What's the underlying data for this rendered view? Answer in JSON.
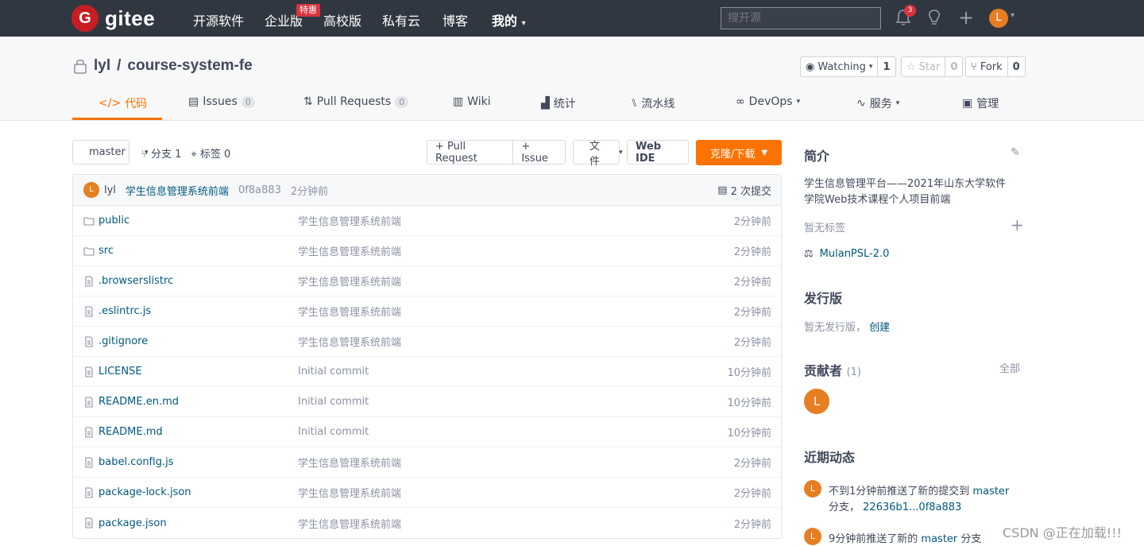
{
  "nav": {
    "logo_letter": "G",
    "logo_text": "gitee",
    "items": [
      "开源软件",
      "企业版",
      "高校版",
      "私有云",
      "博客",
      "我的"
    ],
    "promo_badge": "特惠",
    "search_placeholder": "搜开源",
    "notification_count": "3",
    "avatar_letter": "L"
  },
  "repo": {
    "owner": "lyl",
    "sep": "/",
    "name": "course-system-fe",
    "watch_label": "Watching",
    "watch_count": "1",
    "star_label": "Star",
    "star_count": "0",
    "fork_label": "Fork",
    "fork_count": "0"
  },
  "tabs": [
    {
      "label": "代码",
      "icon": "code-icon"
    },
    {
      "label": "Issues",
      "count": "0",
      "icon": "issues-icon"
    },
    {
      "label": "Pull Requests",
      "count": "0",
      "icon": "pull-request-icon"
    },
    {
      "label": "Wiki",
      "icon": "wiki-icon"
    },
    {
      "label": "统计",
      "icon": "chart-icon"
    },
    {
      "label": "流水线",
      "icon": "pipeline-icon"
    },
    {
      "label": "DevOps",
      "icon": "devops-icon"
    },
    {
      "label": "服务",
      "icon": "service-icon"
    },
    {
      "label": "管理",
      "icon": "manage-icon"
    }
  ],
  "toolbar": {
    "branch": "master",
    "branches": "分支 1",
    "tags": "标签 0",
    "pr_btn": "+ Pull Request",
    "issue_btn": "+ Issue",
    "file_btn": "文件",
    "webide_btn": "Web IDE",
    "clone_btn": "克隆/下载"
  },
  "commit": {
    "avatar_letter": "L",
    "author": "lyl",
    "message": "学生信息管理系统前端",
    "hash": "0f8a883",
    "time": "2分钟前",
    "count": "2 次提交"
  },
  "files": [
    {
      "type": "folder",
      "name": "public",
      "msg": "学生信息管理系统前端",
      "time": "2分钟前"
    },
    {
      "type": "folder",
      "name": "src",
      "msg": "学生信息管理系统前端",
      "time": "2分钟前"
    },
    {
      "type": "file",
      "name": ".browserslistrc",
      "msg": "学生信息管理系统前端",
      "time": "2分钟前"
    },
    {
      "type": "file",
      "name": ".eslintrc.js",
      "msg": "学生信息管理系统前端",
      "time": "2分钟前"
    },
    {
      "type": "file",
      "name": ".gitignore",
      "msg": "学生信息管理系统前端",
      "time": "2分钟前"
    },
    {
      "type": "file",
      "name": "LICENSE",
      "msg": "Initial commit",
      "time": "10分钟前"
    },
    {
      "type": "file",
      "name": "README.en.md",
      "msg": "Initial commit",
      "time": "10分钟前"
    },
    {
      "type": "file",
      "name": "README.md",
      "msg": "Initial commit",
      "time": "10分钟前"
    },
    {
      "type": "file",
      "name": "babel.config.js",
      "msg": "学生信息管理系统前端",
      "time": "2分钟前"
    },
    {
      "type": "file",
      "name": "package-lock.json",
      "msg": "学生信息管理系统前端",
      "time": "2分钟前"
    },
    {
      "type": "file",
      "name": "package.json",
      "msg": "学生信息管理系统前端",
      "time": "2分钟前"
    }
  ],
  "sidebar": {
    "intro_title": "简介",
    "intro_line1": "学生信息管理平台——2021年山东大学软件",
    "intro_line2": "学院Web技术课程个人项目前端",
    "no_tags": "暂无标签",
    "license": "MulanPSL-2.0",
    "release_title": "发行版",
    "no_release": "暂无发行版，",
    "create": "创建",
    "contrib_title": "贡献者",
    "contrib_count": "(1)",
    "all": "全部",
    "contrib_letter": "L",
    "activity_title": "近期动态",
    "act1_text": "不到1分钟前推送了新的提交到",
    "act1_branch": "master",
    "act1_line2a": "分支，",
    "act1_line2b": "22636b1...0f8a883",
    "act2_text": "9分钟前推送了新的",
    "act2_branch": "master",
    "act2_tail": "分支"
  },
  "watermark": "CSDN @正在加载!!!"
}
